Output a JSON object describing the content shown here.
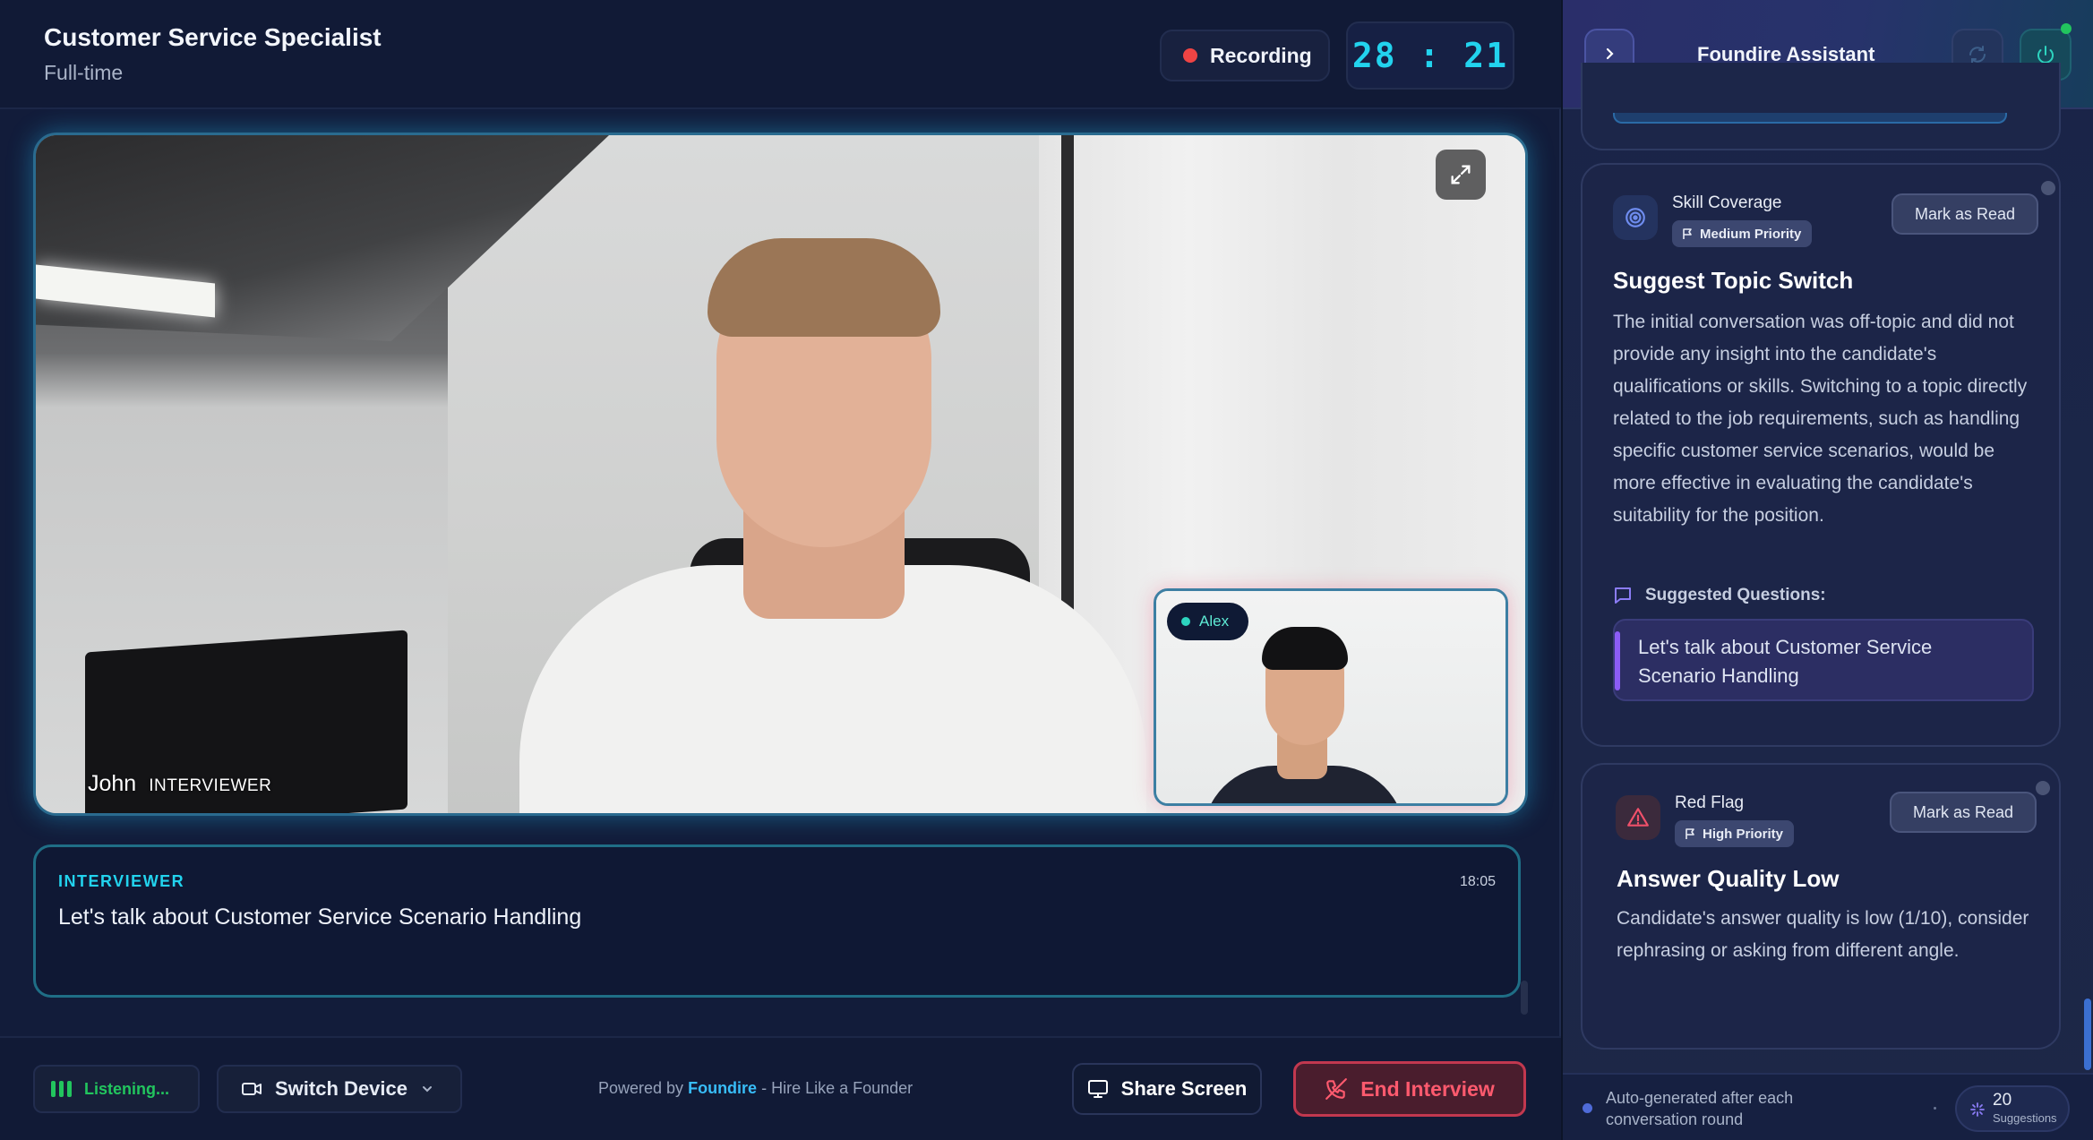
{
  "header": {
    "job_title": "Customer Service Specialist",
    "job_type": "Full-time",
    "recording_label": "Recording",
    "timer": "28 : 21"
  },
  "video": {
    "main_name": "John",
    "main_role": "INTERVIEWER",
    "pip_name": "Alex",
    "expand_icon": "expand-icon"
  },
  "transcript": {
    "role": "INTERVIEWER",
    "time": "18:05",
    "text": "Let's talk about Customer Service  Scenario Handling"
  },
  "footer": {
    "listening_label": "Listening...",
    "switch_device_label": "Switch Device",
    "powered_prefix": "Powered by",
    "powered_brand": "Foundire",
    "powered_suffix": "- Hire Like a Founder",
    "share_screen_label": "Share Screen",
    "end_interview_label": "End Interview"
  },
  "assistant": {
    "title": "Foundire Assistant",
    "cards": [
      {
        "category": "Skill Coverage",
        "priority": "Medium Priority",
        "mark_read_label": "Mark as Read",
        "title": "Suggest Topic Switch",
        "body": "The initial conversation was off-topic and did not provide any insight into the candidate's qualifications or skills. Switching to a topic directly related to the job requirements, such as handling specific customer service scenarios, would be more effective in evaluating the candidate's suitability for the position.",
        "suggested_label": "Suggested Questions:",
        "suggested_question": "Let's talk about Customer Service Scenario Handling"
      },
      {
        "category": "Red Flag",
        "priority": "High Priority",
        "mark_read_label": "Mark as Read",
        "title": "Answer Quality Low",
        "body": "Candidate's answer quality is low (1/10), consider rephrasing or asking from different angle."
      }
    ],
    "footer_text": "Auto-generated after each conversation round",
    "suggestions_count": "20",
    "suggestions_label": "Suggestions"
  },
  "colors": {
    "accent_cyan": "#22d3ee",
    "recording_red": "#ef4444",
    "listening_green": "#22c55e",
    "end_red": "#ff5a6e",
    "brand_blue": "#38bdf8",
    "suggestion_purple": "#8b5cf6"
  }
}
